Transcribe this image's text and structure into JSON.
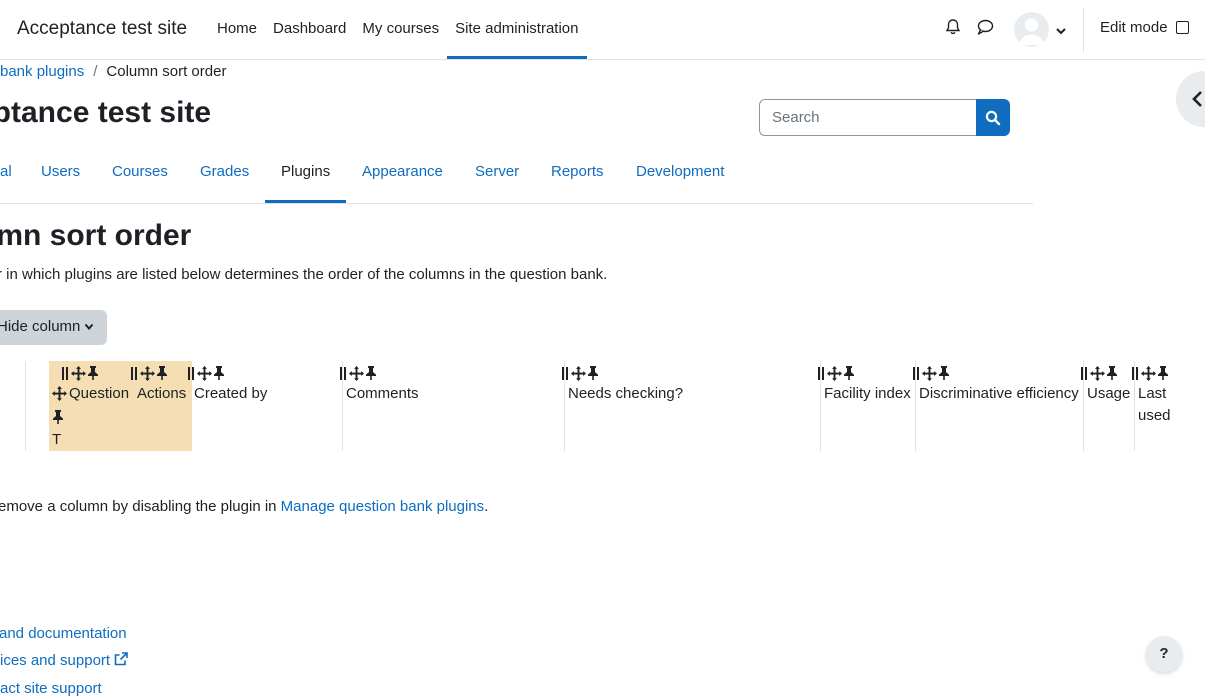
{
  "navbar": {
    "brand": "Acceptance test site",
    "items": [
      "Home",
      "Dashboard",
      "My courses",
      "Site administration"
    ],
    "active_item": "Site administration",
    "edit_mode_label": "Edit mode",
    "edit_mode_checked": false
  },
  "breadcrumb": {
    "parent": "bank plugins",
    "current": "Column sort order"
  },
  "header": {
    "site_heading": "eptance test site",
    "search_placeholder": "Search"
  },
  "secondary_nav": {
    "items": [
      "al",
      "Users",
      "Courses",
      "Grades",
      "Plugins",
      "Appearance",
      "Server",
      "Reports",
      "Development"
    ],
    "active_item": "Plugins"
  },
  "page": {
    "title": "umn sort order",
    "intro": "r in which plugins are listed below determines the order of the columns in the question bank.",
    "hide_button": "Hide column",
    "columns": {
      "t": "T",
      "question": "Question",
      "actions": "Actions",
      "created_by": "Created by",
      "comments": "Comments",
      "needs_checking": "Needs checking?",
      "facility_index": "Facility index",
      "discriminative_efficiency": "Discriminative efficiency",
      "usage": "Usage",
      "last_used": "Last used"
    },
    "footnote_before": "emove a column by disabling the plugin in ",
    "footnote_link": "Manage question bank plugins",
    "footnote_after": "."
  },
  "footer": {
    "links": [
      " and documentation",
      "ices and support",
      "act site support"
    ]
  },
  "help_button": "?",
  "colors": {
    "link": "#0f6cbf",
    "highlight": "#f5deb3",
    "button_grey": "#ced4da"
  }
}
